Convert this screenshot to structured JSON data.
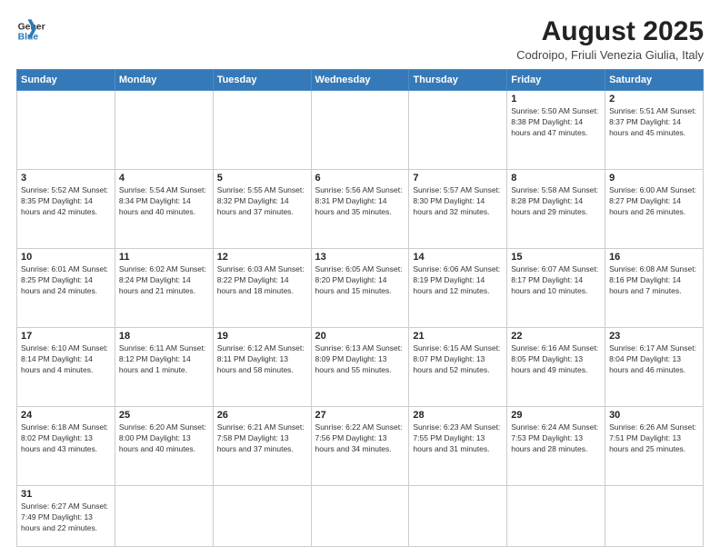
{
  "header": {
    "logo_general": "General",
    "logo_blue": "Blue",
    "month_year": "August 2025",
    "subtitle": "Codroipo, Friuli Venezia Giulia, Italy"
  },
  "weekdays": [
    "Sunday",
    "Monday",
    "Tuesday",
    "Wednesday",
    "Thursday",
    "Friday",
    "Saturday"
  ],
  "weeks": [
    [
      {
        "day": "",
        "info": ""
      },
      {
        "day": "",
        "info": ""
      },
      {
        "day": "",
        "info": ""
      },
      {
        "day": "",
        "info": ""
      },
      {
        "day": "",
        "info": ""
      },
      {
        "day": "1",
        "info": "Sunrise: 5:50 AM\nSunset: 8:38 PM\nDaylight: 14 hours and 47 minutes."
      },
      {
        "day": "2",
        "info": "Sunrise: 5:51 AM\nSunset: 8:37 PM\nDaylight: 14 hours and 45 minutes."
      }
    ],
    [
      {
        "day": "3",
        "info": "Sunrise: 5:52 AM\nSunset: 8:35 PM\nDaylight: 14 hours and 42 minutes."
      },
      {
        "day": "4",
        "info": "Sunrise: 5:54 AM\nSunset: 8:34 PM\nDaylight: 14 hours and 40 minutes."
      },
      {
        "day": "5",
        "info": "Sunrise: 5:55 AM\nSunset: 8:32 PM\nDaylight: 14 hours and 37 minutes."
      },
      {
        "day": "6",
        "info": "Sunrise: 5:56 AM\nSunset: 8:31 PM\nDaylight: 14 hours and 35 minutes."
      },
      {
        "day": "7",
        "info": "Sunrise: 5:57 AM\nSunset: 8:30 PM\nDaylight: 14 hours and 32 minutes."
      },
      {
        "day": "8",
        "info": "Sunrise: 5:58 AM\nSunset: 8:28 PM\nDaylight: 14 hours and 29 minutes."
      },
      {
        "day": "9",
        "info": "Sunrise: 6:00 AM\nSunset: 8:27 PM\nDaylight: 14 hours and 26 minutes."
      }
    ],
    [
      {
        "day": "10",
        "info": "Sunrise: 6:01 AM\nSunset: 8:25 PM\nDaylight: 14 hours and 24 minutes."
      },
      {
        "day": "11",
        "info": "Sunrise: 6:02 AM\nSunset: 8:24 PM\nDaylight: 14 hours and 21 minutes."
      },
      {
        "day": "12",
        "info": "Sunrise: 6:03 AM\nSunset: 8:22 PM\nDaylight: 14 hours and 18 minutes."
      },
      {
        "day": "13",
        "info": "Sunrise: 6:05 AM\nSunset: 8:20 PM\nDaylight: 14 hours and 15 minutes."
      },
      {
        "day": "14",
        "info": "Sunrise: 6:06 AM\nSunset: 8:19 PM\nDaylight: 14 hours and 12 minutes."
      },
      {
        "day": "15",
        "info": "Sunrise: 6:07 AM\nSunset: 8:17 PM\nDaylight: 14 hours and 10 minutes."
      },
      {
        "day": "16",
        "info": "Sunrise: 6:08 AM\nSunset: 8:16 PM\nDaylight: 14 hours and 7 minutes."
      }
    ],
    [
      {
        "day": "17",
        "info": "Sunrise: 6:10 AM\nSunset: 8:14 PM\nDaylight: 14 hours and 4 minutes."
      },
      {
        "day": "18",
        "info": "Sunrise: 6:11 AM\nSunset: 8:12 PM\nDaylight: 14 hours and 1 minute."
      },
      {
        "day": "19",
        "info": "Sunrise: 6:12 AM\nSunset: 8:11 PM\nDaylight: 13 hours and 58 minutes."
      },
      {
        "day": "20",
        "info": "Sunrise: 6:13 AM\nSunset: 8:09 PM\nDaylight: 13 hours and 55 minutes."
      },
      {
        "day": "21",
        "info": "Sunrise: 6:15 AM\nSunset: 8:07 PM\nDaylight: 13 hours and 52 minutes."
      },
      {
        "day": "22",
        "info": "Sunrise: 6:16 AM\nSunset: 8:05 PM\nDaylight: 13 hours and 49 minutes."
      },
      {
        "day": "23",
        "info": "Sunrise: 6:17 AM\nSunset: 8:04 PM\nDaylight: 13 hours and 46 minutes."
      }
    ],
    [
      {
        "day": "24",
        "info": "Sunrise: 6:18 AM\nSunset: 8:02 PM\nDaylight: 13 hours and 43 minutes."
      },
      {
        "day": "25",
        "info": "Sunrise: 6:20 AM\nSunset: 8:00 PM\nDaylight: 13 hours and 40 minutes."
      },
      {
        "day": "26",
        "info": "Sunrise: 6:21 AM\nSunset: 7:58 PM\nDaylight: 13 hours and 37 minutes."
      },
      {
        "day": "27",
        "info": "Sunrise: 6:22 AM\nSunset: 7:56 PM\nDaylight: 13 hours and 34 minutes."
      },
      {
        "day": "28",
        "info": "Sunrise: 6:23 AM\nSunset: 7:55 PM\nDaylight: 13 hours and 31 minutes."
      },
      {
        "day": "29",
        "info": "Sunrise: 6:24 AM\nSunset: 7:53 PM\nDaylight: 13 hours and 28 minutes."
      },
      {
        "day": "30",
        "info": "Sunrise: 6:26 AM\nSunset: 7:51 PM\nDaylight: 13 hours and 25 minutes."
      }
    ],
    [
      {
        "day": "31",
        "info": "Sunrise: 6:27 AM\nSunset: 7:49 PM\nDaylight: 13 hours and 22 minutes."
      },
      {
        "day": "",
        "info": ""
      },
      {
        "day": "",
        "info": ""
      },
      {
        "day": "",
        "info": ""
      },
      {
        "day": "",
        "info": ""
      },
      {
        "day": "",
        "info": ""
      },
      {
        "day": "",
        "info": ""
      }
    ]
  ]
}
